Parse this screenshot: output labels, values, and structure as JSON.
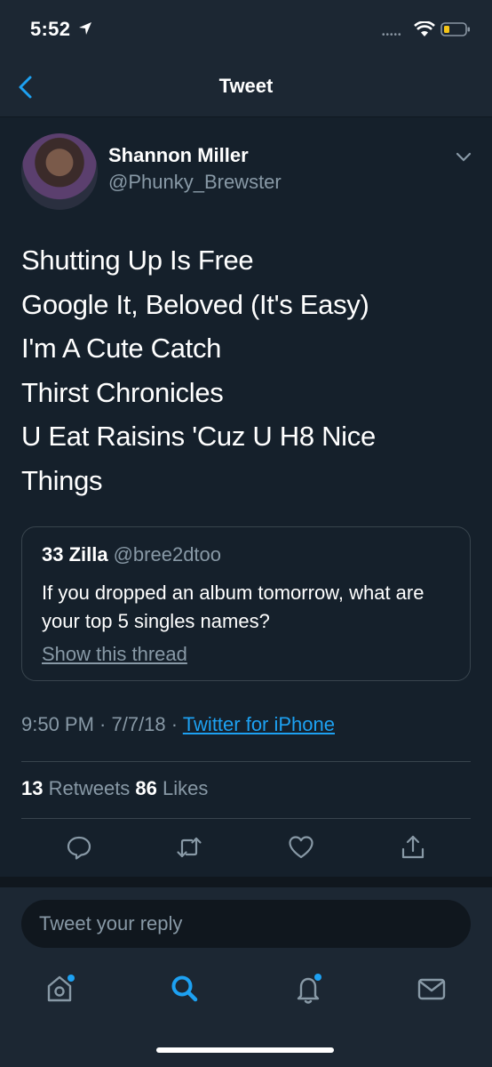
{
  "status_bar": {
    "time": "5:52",
    "signal": "•••••"
  },
  "header": {
    "title": "Tweet"
  },
  "tweet": {
    "author_name": "Shannon Miller",
    "author_handle": "@Phunky_Brewster",
    "text": "Shutting Up Is Free\nGoogle It, Beloved (It's Easy)\nI'm A Cute Catch\nThirst Chronicles\nU Eat Raisins 'Cuz U H8 Nice\nThings",
    "time": "9:50 PM · 7/7/18 · ",
    "source": "Twitter for iPhone"
  },
  "quote": {
    "name": "33 Zilla",
    "handle": "@bree2dtoo",
    "text": "If you dropped an album tomorrow, what are your top 5 singles names?",
    "link": "Show this thread"
  },
  "stats": {
    "retweets_count": "13",
    "retweets_label": " Retweets ",
    "likes_count": "86",
    "likes_label": " Likes"
  },
  "reply": {
    "placeholder": "Tweet your reply"
  },
  "colors": {
    "accent": "#1da1f2",
    "background": "#15202b",
    "muted": "#8899a6"
  },
  "icons": [
    "location-arrow-icon",
    "wifi-icon",
    "battery-icon",
    "back-icon",
    "chevron-down-icon",
    "reply-icon",
    "retweet-icon",
    "like-icon",
    "share-icon",
    "home-icon",
    "search-icon",
    "notifications-icon",
    "messages-icon"
  ]
}
